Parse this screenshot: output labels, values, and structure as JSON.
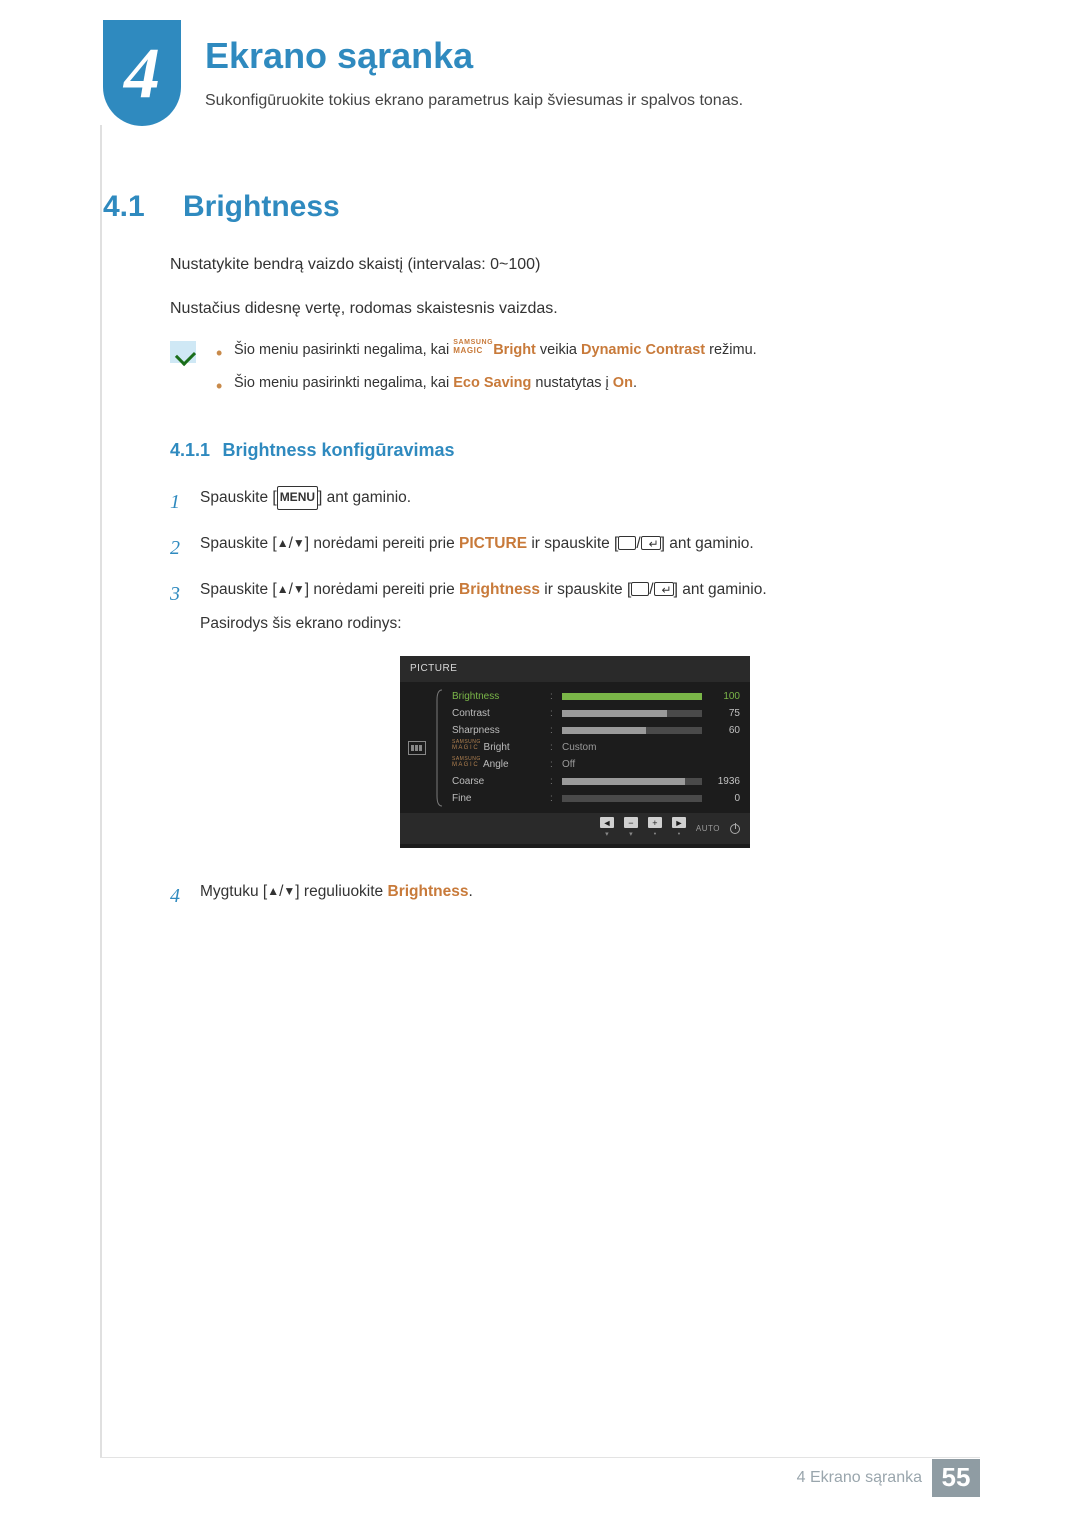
{
  "chapter": {
    "number": "4",
    "title": "Ekrano sąranka",
    "description": "Sukonfigūruokite tokius ekrano parametrus kaip šviesumas ir spalvos tonas."
  },
  "section": {
    "number": "4.1",
    "title": "Brightness",
    "para1": "Nustatykite bendrą vaizdo skaistį (intervalas: 0~100)",
    "para2": "Nustačius didesnę vertę, rodomas skaistesnis vaizdas."
  },
  "notes": {
    "item1_pre": "Šio meniu pasirinkti negalima, kai ",
    "item1_magic_top": "SAMSUNG",
    "item1_magic_bot": "MAGIC",
    "item1_bright": "Bright",
    "item1_mid": " veikia ",
    "item1_bold": "Dynamic Contrast",
    "item1_post": " režimu.",
    "item2_pre": "Šio meniu pasirinkti negalima, kai ",
    "item2_eco": "Eco Saving",
    "item2_mid": " nustatytas į ",
    "item2_on": "On",
    "item2_post": "."
  },
  "subsection": {
    "number": "4.1.1",
    "title": "Brightness konfigūravimas"
  },
  "steps": {
    "s1_pre": "Spauskite [",
    "s1_menu": "MENU",
    "s1_post": "] ant gaminio.",
    "s2_pre": "Spauskite [",
    "s2_mid1": "] norėdami pereiti prie ",
    "s2_pic": "PICTURE",
    "s2_mid2": " ir spauskite [",
    "s2_post": "] ant gaminio.",
    "s3_pre": "Spauskite [",
    "s3_mid1": "] norėdami pereiti prie ",
    "s3_bright": "Brightness",
    "s3_mid2": " ir spauskite [",
    "s3_post": "] ant gaminio.",
    "s3_below": "Pasirodys šis ekrano rodinys:",
    "s4_pre": "Mygtuku [",
    "s4_mid": "] reguliuokite ",
    "s4_bright": "Brightness",
    "s4_post": "."
  },
  "osd": {
    "header": "PICTURE",
    "rows": [
      {
        "label": "Brightness",
        "type": "bar",
        "value": 100,
        "max": 100,
        "hl": true
      },
      {
        "label": "Contrast",
        "type": "bar",
        "value": 75,
        "max": 100
      },
      {
        "label": "Sharpness",
        "type": "bar",
        "value": 60,
        "max": 100
      },
      {
        "label_pre": "",
        "magic": true,
        "label_suf": " Bright",
        "type": "text",
        "text": "Custom"
      },
      {
        "label_pre": "",
        "magic": true,
        "label_suf": " Angle",
        "type": "text",
        "text": "Off"
      },
      {
        "label": "Coarse",
        "type": "bar",
        "value": 1936,
        "max": 2200,
        "display": "1936"
      },
      {
        "label": "Fine",
        "type": "bar",
        "value": 0,
        "max": 100,
        "display": "0"
      }
    ],
    "magic_top": "SAMSUNG",
    "magic_bot": "M A G I C",
    "footer_auto": "AUTO"
  },
  "footer": {
    "text": "4 Ekrano sąranka",
    "page": "55"
  }
}
